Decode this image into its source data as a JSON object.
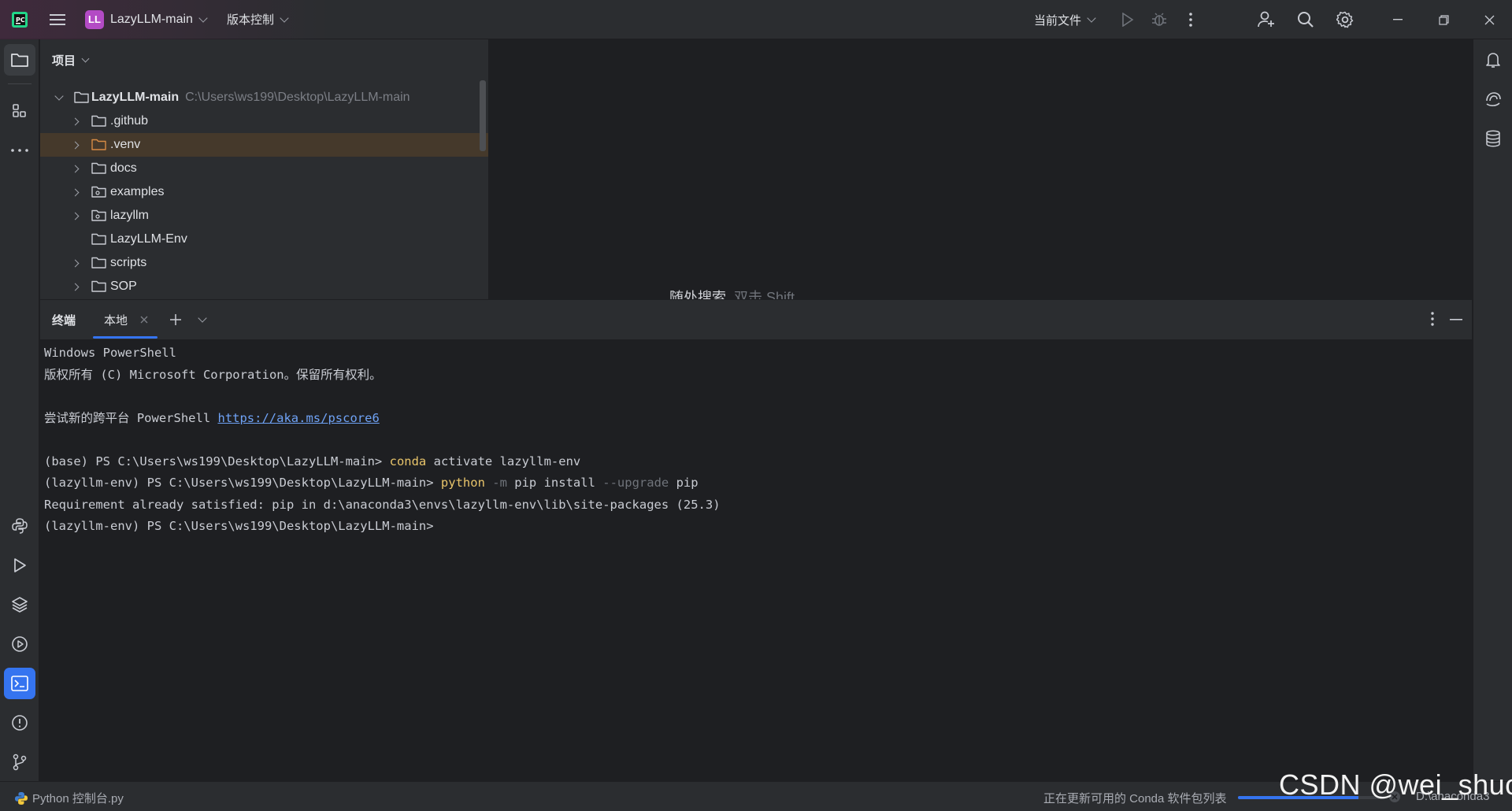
{
  "titlebar": {
    "project_initials": "LL",
    "project_name": "LazyLLM-main",
    "vcs_label": "版本控制",
    "run_config": "当前文件"
  },
  "project_panel": {
    "header": "项目",
    "root": {
      "name": "LazyLLM-main",
      "path": "C:\\Users\\ws199\\Desktop\\LazyLLM-main"
    },
    "items": [
      {
        "name": ".github",
        "expandable": true
      },
      {
        "name": ".venv",
        "expandable": true
      },
      {
        "name": "docs",
        "expandable": true
      },
      {
        "name": "examples",
        "expandable": true
      },
      {
        "name": "lazyllm",
        "expandable": true
      },
      {
        "name": "LazyLLM-Env",
        "expandable": false
      },
      {
        "name": "scripts",
        "expandable": true
      },
      {
        "name": "SOP",
        "expandable": true
      }
    ]
  },
  "editor": {
    "hint_label": "随处搜索",
    "hint_key": "双击 Shift"
  },
  "terminal": {
    "title": "终端",
    "tab_label": "本地",
    "lines": {
      "l1": "Windows PowerShell",
      "l2": "版权所有 (C) Microsoft Corporation。保留所有权利。",
      "l3_prefix": "尝试新的跨平台 PowerShell ",
      "l3_link": "https://aka.ms/pscore6",
      "l4_prompt": "(base) PS C:\\Users\\ws199\\Desktop\\LazyLLM-main> ",
      "l4_cmd": "conda",
      "l4_args": " activate lazyllm-env",
      "l5_prompt": "(lazyllm-env) PS C:\\Users\\ws199\\Desktop\\LazyLLM-main> ",
      "l5_cmd": "python",
      "l5_flag1": " -m",
      "l5_mid": " pip install ",
      "l5_flag2": "--upgrade",
      "l5_end": " pip",
      "l6": "Requirement already satisfied: pip in d:\\anaconda3\\envs\\lazyllm-env\\lib\\site-packages (25.3)",
      "l7": "(lazyllm-env) PS C:\\Users\\ws199\\Desktop\\LazyLLM-main> "
    }
  },
  "statusbar": {
    "left_file": "Python 控制台.py",
    "task_text": "正在更新可用的 Conda 软件包列表",
    "progress": 0.82,
    "interpreter": "D:\\anaconda3"
  },
  "watermark": "CSDN @wei_shuo",
  "colors": {
    "accent": "#3574f0",
    "project_badge": "#b34bc5",
    "command": "#e8c46a"
  }
}
